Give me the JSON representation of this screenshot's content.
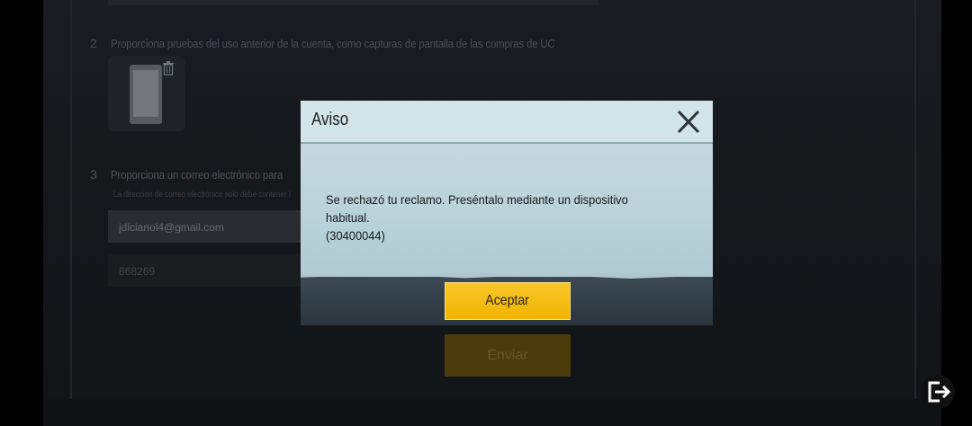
{
  "form": {
    "step2": {
      "number": "2",
      "text": "Proporciona pruebas del uso anterior de la cuenta, como capturas de pantalla de las compras de UC"
    },
    "step3": {
      "number": "3",
      "text": "Proporciona un correo electrónico para",
      "subtext": "La dirección de correo electrónico solo debe contener l"
    },
    "email_value": "jdicianol4@gmail.com",
    "code_value": "868269",
    "send_label": "Enviar"
  },
  "dialog": {
    "title": "Aviso",
    "message_line1": "Se rechazó tu reclamo. Preséntalo mediante un dispositivo habitual.",
    "message_line2": "(30400044)",
    "ok_label": "Aceptar"
  },
  "icons": {
    "close": "close-icon",
    "trash": "trash-icon",
    "exit": "exit-icon"
  },
  "colors": {
    "accent": "#f0b400",
    "dialog_bg": "#c9dde2"
  }
}
